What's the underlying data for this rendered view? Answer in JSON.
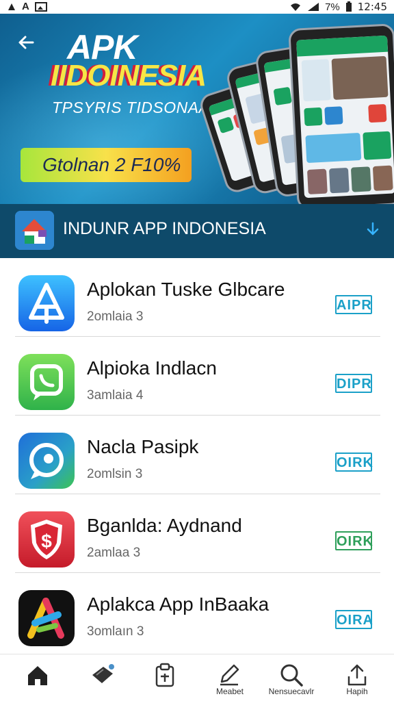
{
  "status_bar": {
    "left_icons": [
      "notification-a-icon",
      "notification-b-icon",
      "image-icon"
    ],
    "left_text": [
      "A"
    ],
    "battery": "7%",
    "time": "12:45"
  },
  "hero": {
    "title_line1": "APK",
    "title_line2": "IIDOINESIA",
    "subtitle": "TPSYRIS TIDSONAA",
    "cta_label": "Gtolnan 2 F10%",
    "cta_colors": [
      "#a7e63c",
      "#f8e14a",
      "#f4a020"
    ]
  },
  "section": {
    "title": "INDUNR APP INDONESIA",
    "download_icon": "download-icon",
    "background": "#0e4a6a"
  },
  "apps": [
    {
      "name": "Aplokan Tuske Glbcare",
      "subtitle": "2omlaia 3",
      "badge": "AIPR",
      "badge_color": "#1aa0c8",
      "icon": "blue-a-app-icon"
    },
    {
      "name": "Alpioka Indlacn",
      "subtitle": "3amlaia 4",
      "badge": "DIPR",
      "badge_color": "#1aa0c8",
      "icon": "whatsapp-style-app-icon"
    },
    {
      "name": "Nacla Pasipk",
      "subtitle": "2omlsin 3",
      "badge": "OIRK",
      "badge_color": "#1aa0c8",
      "icon": "chat-bubble-app-icon"
    },
    {
      "name": "Bganlda: Aydnand",
      "subtitle": "2amlaa 3",
      "badge": "OIRK",
      "badge_color": "#2e9f5a",
      "icon": "shield-dollar-app-icon"
    },
    {
      "name": "Aplakca App InBaaka",
      "subtitle": "3omlaın 3",
      "badge": "OIRA",
      "badge_color": "#1aa0c8",
      "icon": "colorful-a-app-icon"
    }
  ],
  "bottom_nav": [
    {
      "label": "",
      "icon": "home-icon"
    },
    {
      "label": "",
      "icon": "tag-icon"
    },
    {
      "label": "",
      "icon": "clipboard-icon"
    },
    {
      "label": "Meabet",
      "icon": "edit-icon"
    },
    {
      "label": "Nensuecavlr",
      "icon": "search-icon"
    },
    {
      "label": "Hapih",
      "icon": "share-icon"
    }
  ]
}
